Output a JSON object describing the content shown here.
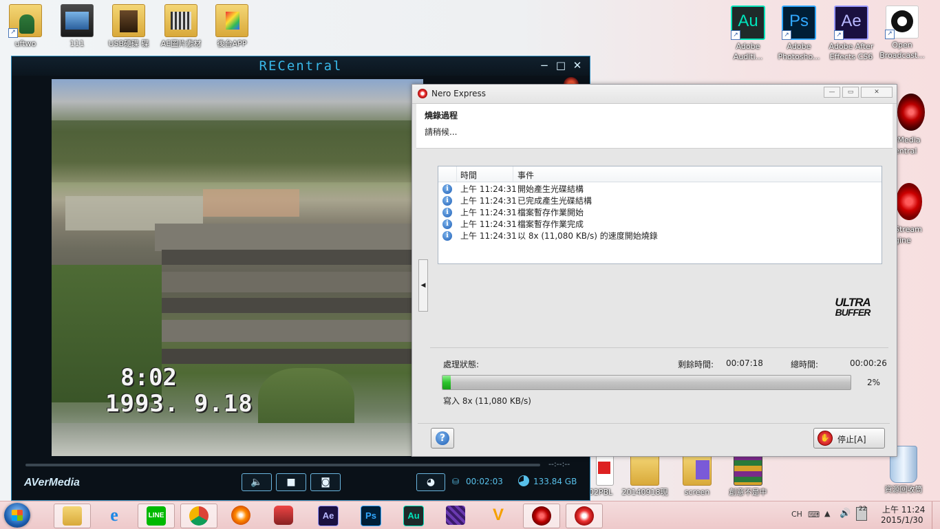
{
  "desktop": {
    "left_icons": [
      "uftwo",
      "111",
      "USB硬碟 碟",
      "AE圖片素材",
      "後台APP"
    ],
    "right_icons": [
      {
        "label": "Adobe Auditi...",
        "glyph": "Au",
        "color": "#00e4bb",
        "bg": "#1f2a2a"
      },
      {
        "label": "Adobe Photosho...",
        "glyph": "Ps",
        "color": "#31a8ff",
        "bg": "#001e36"
      },
      {
        "label": "Adobe After Effects CS6",
        "glyph": "Ae",
        "color": "#9999ff",
        "bg": "#00005b"
      },
      {
        "label": "Open Broadcast...",
        "glyph": "",
        "color": "#111111",
        "bg": "#ffffff"
      }
    ],
    "partial_icons": [
      "rMedia entral",
      "Stream gine"
    ],
    "bottom_icons": [
      "02PBL",
      "20140918現",
      "screen",
      "創意不是中",
      "資源回收筒"
    ]
  },
  "recentral": {
    "title": "RECentral",
    "stamp_time": "8:02",
    "stamp_date": "1993. 9.18",
    "time_code": "--:--:--",
    "brand": "AVerMedia",
    "record_time": "00:02:03",
    "disk_free": "133.84 GB",
    "colors": {
      "accent": "#39b8e8",
      "frame": "#0a1118"
    }
  },
  "nero": {
    "title": "Nero Express",
    "header_title": "燒錄過程",
    "header_sub": "請稍候...",
    "log": {
      "col_time": "時間",
      "col_event": "事件",
      "rows": [
        {
          "time": "上午 11:24:31",
          "event": "開始產生光碟結構"
        },
        {
          "time": "上午 11:24:31",
          "event": "已完成產生光碟結構"
        },
        {
          "time": "上午 11:24:31",
          "event": "檔案暫存作業開始"
        },
        {
          "time": "上午 11:24:31",
          "event": "檔案暫存作業完成"
        },
        {
          "time": "上午 11:24:31",
          "event": "以 8x (11,080 KB/s) 的速度開始燒錄"
        }
      ]
    },
    "logo_line1": "ULTRA",
    "logo_line2": "BUFFER",
    "status_label": "處理狀態:",
    "remaining_label": "剩餘時間:",
    "remaining_value": "00:07:18",
    "total_label": "總時間:",
    "total_value": "00:00:26",
    "progress_percent": 2,
    "progress_text": "2%",
    "write_speed": "寫入 8x (11,080 KB/s)",
    "help_label": "?",
    "stop_label": "停止[A]",
    "colors": {
      "progress": "#2cc42c"
    }
  },
  "taskbar": {
    "apps": [
      "Windows Explorer",
      "Internet Explorer",
      "LINE",
      "Chrome",
      "Nero",
      "Scratch",
      "Ae",
      "Ps",
      "Au",
      "Premiere",
      "Vegas",
      "RECentral",
      "Nero Express"
    ],
    "app_glyphs": [
      "",
      "e",
      "LINE",
      "",
      "",
      "",
      "Ae",
      "Ps",
      "Au",
      "",
      "V",
      "",
      ""
    ],
    "lang": "CH",
    "time": "上午 11:24",
    "date": "2015/1/30",
    "badge": "22"
  }
}
